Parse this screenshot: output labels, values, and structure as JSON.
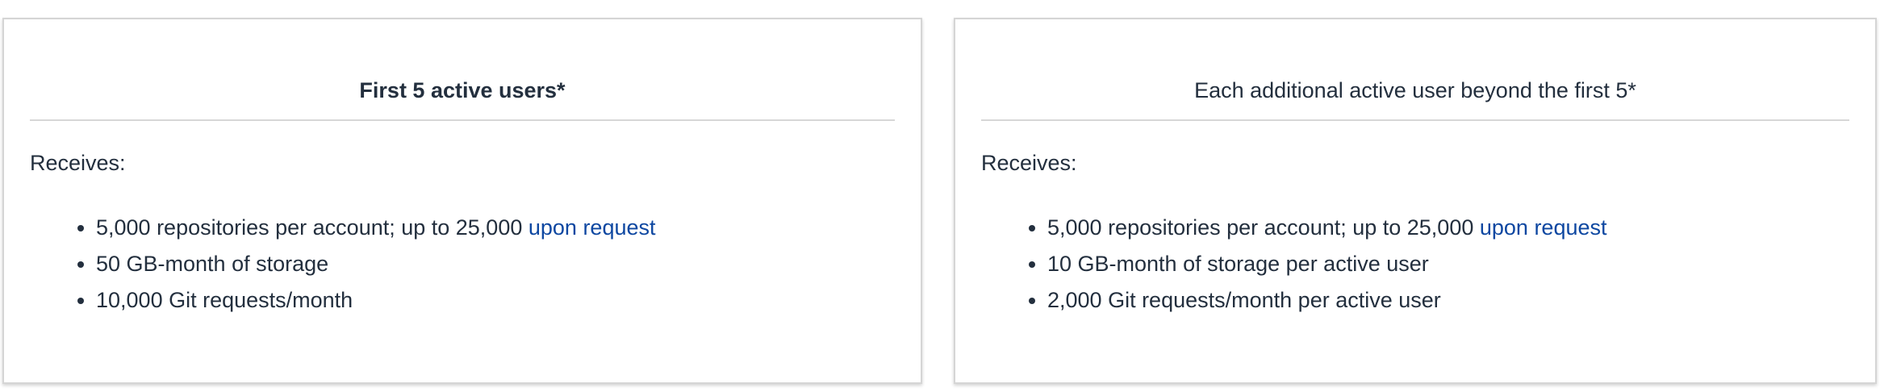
{
  "cards": [
    {
      "heading": "First 5 active users*",
      "receives": "Receives:",
      "items": [
        {
          "text": "5,000 repositories per account; up to 25,000 ",
          "link": "upon request"
        },
        {
          "text": "50 GB-month of storage"
        },
        {
          "text": "10,000 Git requests/month"
        }
      ]
    },
    {
      "heading": "Each additional active user beyond the first 5*",
      "receives": "Receives:",
      "items": [
        {
          "text": "5,000 repositories per account; up to 25,000 ",
          "link": "upon request"
        },
        {
          "text": "10 GB-month of storage per active user"
        },
        {
          "text": "2,000 Git requests/month per active user"
        }
      ]
    }
  ],
  "colors": {
    "link": "#0d47a1",
    "text": "#232f3e",
    "border": "#d5d5d5"
  }
}
